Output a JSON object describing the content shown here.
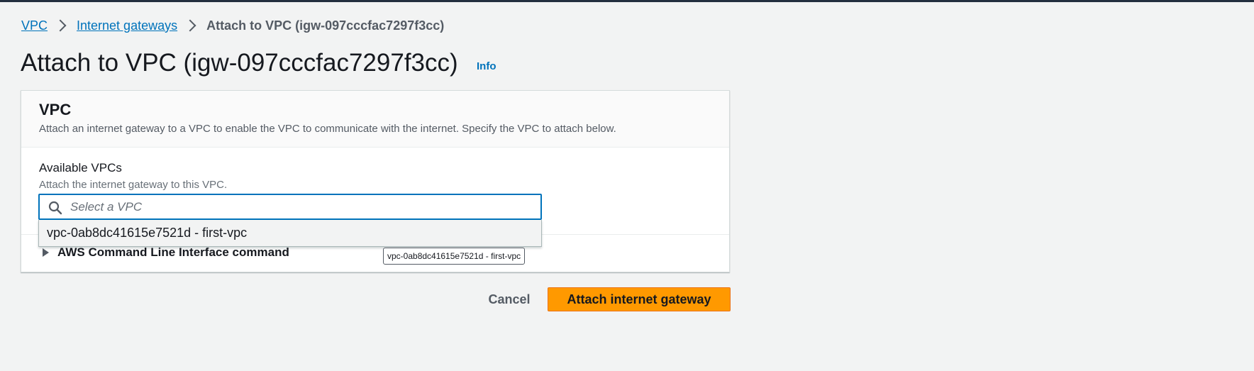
{
  "breadcrumb": {
    "items": [
      {
        "label": "VPC"
      },
      {
        "label": "Internet gateways"
      },
      {
        "label": "Attach to VPC (igw-097cccfac7297f3cc)"
      }
    ]
  },
  "page": {
    "title": "Attach to VPC (igw-097cccfac7297f3cc)",
    "info_label": "Info"
  },
  "section": {
    "title": "VPC",
    "description": "Attach an internet gateway to a VPC to enable the VPC to communicate with the internet. Specify the VPC to attach below."
  },
  "field": {
    "label": "Available VPCs",
    "description": "Attach the internet gateway to this VPC.",
    "placeholder": "Select a VPC",
    "value": "",
    "icon": "search-icon"
  },
  "dropdown": {
    "options": [
      {
        "label": "vpc-0ab8dc41615e7521d - first-vpc"
      }
    ]
  },
  "tooltip": {
    "text": "vpc-0ab8dc41615e7521d - first-vpc"
  },
  "cli": {
    "label": "AWS Command Line Interface command",
    "icon": "caret-right-icon"
  },
  "actions": {
    "cancel_label": "Cancel",
    "submit_label": "Attach internet gateway"
  },
  "colors": {
    "accent": "#ff9900",
    "link": "#0073bb",
    "background": "#f2f3f3"
  }
}
